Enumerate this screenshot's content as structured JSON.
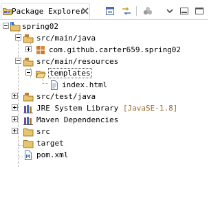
{
  "view": {
    "tab_title": "Package Explorer",
    "tab_close_glyph": "✕",
    "toolbar": [
      "collapse-all-icon",
      "link-with-editor-icon",
      "focus-on-working-set-icon",
      "view-menu-icon",
      "minimize-icon",
      "maximize-icon"
    ]
  },
  "tree": {
    "project": {
      "label": "spring02",
      "icon": "java-project-icon",
      "expanded": true
    },
    "src_main_java": {
      "label": "src/main/java",
      "icon": "source-folder-icon",
      "expanded": true
    },
    "package": {
      "label": "com.github.carter659.spring02",
      "icon": "package-icon",
      "expanded": false
    },
    "src_main_resources": {
      "label": "src/main/resources",
      "icon": "source-folder-icon",
      "expanded": true
    },
    "templates": {
      "label": "templates",
      "icon": "folder-open-icon",
      "expanded": true
    },
    "index_html": {
      "label": "index.html",
      "icon": "file-icon"
    },
    "src_test_java": {
      "label": "src/test/java",
      "icon": "source-folder-icon",
      "expanded": false
    },
    "jre": {
      "label": "JRE System Library",
      "decoration": "[JavaSE-1.8]",
      "icon": "library-icon",
      "expanded": false
    },
    "maven": {
      "label": "Maven Dependencies",
      "icon": "library-icon",
      "expanded": false
    },
    "src": {
      "label": "src",
      "icon": "folder-icon",
      "expanded": false
    },
    "target": {
      "label": "target",
      "icon": "folder-icon"
    },
    "pom": {
      "label": "pom.xml",
      "icon": "maven-file-icon"
    }
  },
  "colors": {
    "accent": "#2a63b8",
    "folder": "#e8c46a",
    "decoration": "#9a6a2a"
  }
}
